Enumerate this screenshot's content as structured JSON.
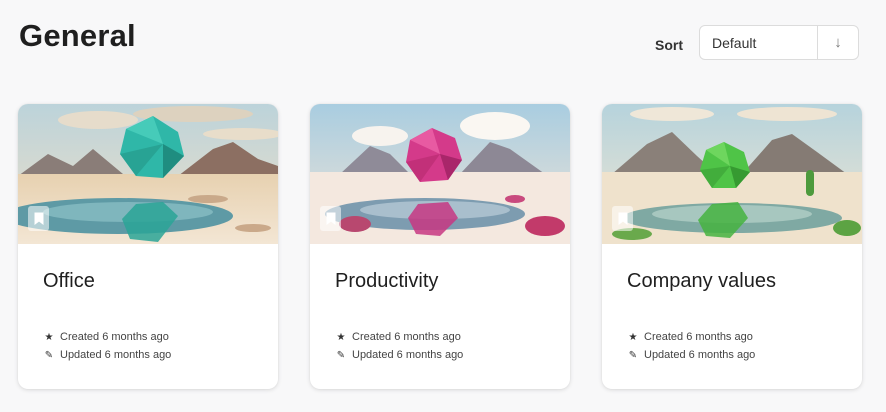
{
  "page": {
    "title": "General"
  },
  "sort": {
    "label": "Sort",
    "value": "Default",
    "direction_icon": "arrow-down-icon"
  },
  "cards": [
    {
      "title": "Office",
      "created": "Created 6 months ago",
      "updated": "Updated 6 months ago",
      "accent": "#2fb7a8",
      "bookmark_icon": "bookmark-icon"
    },
    {
      "title": "Productivity",
      "created": "Created 6 months ago",
      "updated": "Updated 6 months ago",
      "accent": "#d43a8a",
      "bookmark_icon": "bookmark-icon"
    },
    {
      "title": "Company values",
      "created": "Created 6 months ago",
      "updated": "Updated 6 months ago",
      "accent": "#4fc447",
      "bookmark_icon": "bookmark-icon"
    }
  ],
  "icons": {
    "created": "star-icon",
    "updated": "pencil-icon"
  }
}
